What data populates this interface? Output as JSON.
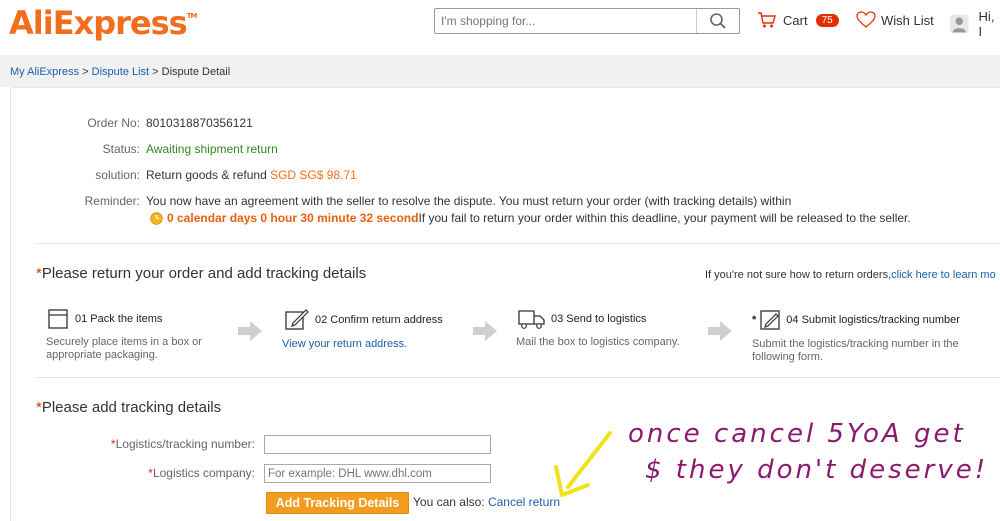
{
  "header": {
    "logo_text": "AliExpress",
    "logo_tm": "TM",
    "search_placeholder": "I'm shopping for...",
    "cart_label": "Cart",
    "cart_count": "75",
    "wishlist_label": "Wish List",
    "greeting": "Hi, I"
  },
  "breadcrumb": {
    "item1": "My AliExpress",
    "sep1": " > ",
    "item2": "Dispute List",
    "sep2": " > ",
    "item3": "Dispute Detail"
  },
  "order": {
    "order_no_label": "Order No:",
    "order_no": "8010318870356121",
    "status_label": "Status:",
    "status": "Awaiting shipment return",
    "solution_label": "solution:",
    "solution_text": "Return goods & refund",
    "solution_amount": "SGD SG$ 98.71",
    "reminder_label": "Reminder:",
    "reminder_line1": "You now have an agreement with the seller to resolve the dispute. You must return your order (with tracking details) within",
    "countdown": "0 calendar days 0 hour 30 minute 32 second",
    "reminder_line2": " If you fail to return your order within this deadline, your payment will be released to the seller."
  },
  "return_section": {
    "required_mark": "*",
    "title": "Please return your order and add tracking details",
    "helper_text": "If you're not sure how to return orders,",
    "helper_link": "click here to learn mo",
    "steps": [
      {
        "title": "01 Pack the items",
        "desc": "Securely place items in a box or appropriate packaging.",
        "link": ""
      },
      {
        "title": "02 Confirm return address",
        "desc": "",
        "link": "View your return address."
      },
      {
        "title": "03 Send to logistics",
        "desc": "Mail the box to logistics company.",
        "link": ""
      },
      {
        "title": "04 Submit logistics/tracking number",
        "desc": "Submit the logistics/tracking number in the following form.",
        "link": ""
      }
    ],
    "step4_marker": "*"
  },
  "tracking_section": {
    "required_mark": "*",
    "title": "Please add tracking details",
    "tracking_label": "Logistics/tracking number:",
    "tracking_value": "",
    "company_label": "Logistics company:",
    "company_placeholder": "For example: DHL www.dhl.com",
    "submit_label": "Add Tracking Details",
    "also_text": "You can also: ",
    "cancel_link": "Cancel return"
  },
  "annotation": {
    "line1": "once cancel 5YoA get",
    "line2": "$ they don't deserve!"
  },
  "colors": {
    "brand_orange": "#f26d1d",
    "link_blue": "#1a5fa8",
    "status_green": "#2e8b1f",
    "annotation_purple": "#8b1a6e",
    "arrow_yellow": "#f2e21c"
  }
}
